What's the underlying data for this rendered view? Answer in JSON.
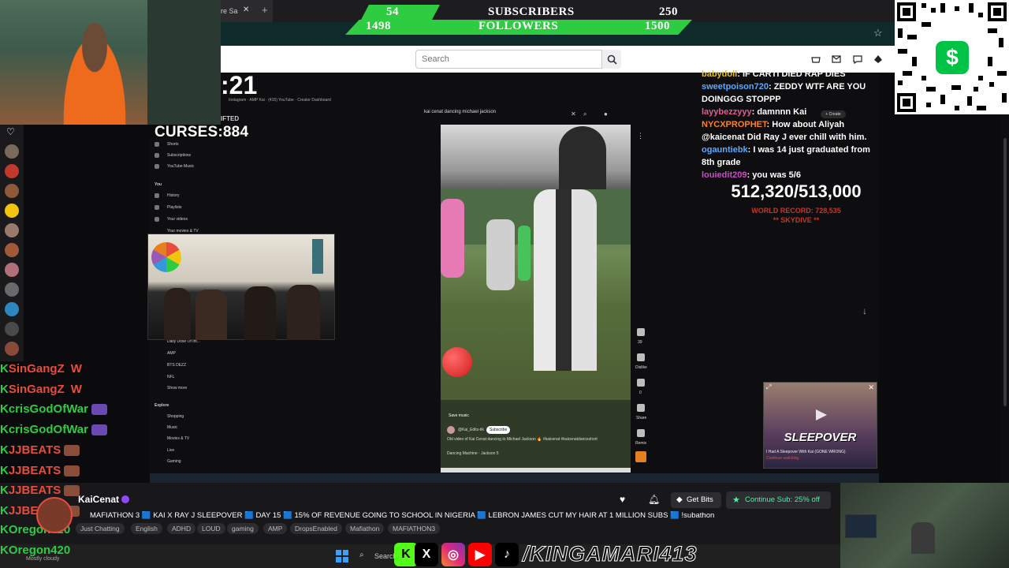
{
  "browser": {
    "tab_title": "re Sa",
    "new_tab_icon": "plus-icon",
    "bookmark_icon": "star-icon"
  },
  "overlay_counter": {
    "subs_current": "54",
    "subs_label": "SUBSCRIBERS",
    "subs_goal": "250",
    "followers_current": "1498",
    "followers_label": "FOLLOWERS",
    "followers_goal": "1500",
    "accent": "#2ecc40"
  },
  "header": {
    "search_placeholder": "Search",
    "icons": [
      "search-icon",
      "cart-icon",
      "inbox-icon",
      "chat-icon",
      "bits-icon"
    ]
  },
  "stream": {
    "timer": ":21",
    "curses": "CURSES:884",
    "browser_label": "IFTED",
    "yt_search_text": "kai cenat dancing michael jackson",
    "yt_sidebar": {
      "items_top": [
        "Shorts",
        "Subscriptions",
        "YouTube Music"
      ],
      "you_label": "You",
      "you_items": [
        "History",
        "Playlists",
        "Your videos",
        "Your movies & TV"
      ],
      "subs": [
        "Daily Dose Of Int...",
        "AMP",
        "BTS DEZZ",
        "NFL",
        "Show more"
      ],
      "explore_label": "Explore",
      "explore_items": [
        "Shopping",
        "Music",
        "Movies & TV",
        "Live",
        "Gaming"
      ]
    },
    "short": {
      "save_music": "Save music",
      "channel": "@Kai_Edits-tik",
      "subscribe": "Subscribe",
      "description": "Old video of Kai Cenat dancing to Michael Jackson 🔥 #kaicenat #kaicenatdanceshort",
      "music": "Dancing Machine · Jackson 5",
      "likes": "39",
      "dislike": "Dislike",
      "comments": "0",
      "share": "Share",
      "remix": "Remix"
    }
  },
  "chat_overlay": [
    {
      "user": "babydoll",
      "msg": ": IF CARTI DIED RAP DIES",
      "color": "#e6c229"
    },
    {
      "user": "sweetpoison720",
      "msg": ": ZEDDY WTF ARE YOU DOINGGG STOPPP",
      "color": "#5aa9ff"
    },
    {
      "user": "layybezzyyy",
      "msg": ": damnnn Kai",
      "color": "#e05d8c"
    },
    {
      "user": "NYCXPROPHET",
      "msg": ": How about Aliyah @kaicenat Did Ray J ever chill with him.",
      "color": "#ff7f24"
    },
    {
      "user": "ogauntiebk",
      "msg": ": I was 14 just graduated from 8th grade",
      "color": "#5aa9ff"
    },
    {
      "user": "louiedit209",
      "msg": ": you was 5/6",
      "color": "#c84ec2"
    }
  ],
  "sub_goal": {
    "count": "512,320/513,000",
    "world_record": "WORLD RECORD: 728,535",
    "next": "** SKYDIVE **"
  },
  "mini_player": {
    "title": "SLEEPOVER",
    "caption": "I Had A Sleepover With Kai (GONE WRONG)",
    "sub_caption": "Continue watching"
  },
  "left_chat": [
    {
      "name": "SinGangZ",
      "suffix": "W",
      "color": "#e74c3c"
    },
    {
      "name": "SinGangZ",
      "suffix": "W",
      "color": "#e74c3c"
    },
    {
      "name": "crisGodOfWar",
      "suffix": "",
      "color": "#2ecc40"
    },
    {
      "name": "crisGodOfWar",
      "suffix": "",
      "color": "#2ecc40"
    },
    {
      "name": "JJBEATS",
      "suffix": "",
      "color": "#e74c3c"
    },
    {
      "name": "JJBEATS",
      "suffix": "",
      "color": "#e74c3c"
    },
    {
      "name": "JJBEATS",
      "suffix": "",
      "color": "#e74c3c"
    },
    {
      "name": "JJBEATS",
      "suffix": "",
      "color": "#e74c3c"
    },
    {
      "name": "Oregon420",
      "suffix": "",
      "color": "#2ecc40"
    },
    {
      "name": "Oregon420",
      "suffix": "",
      "color": "#2ecc40"
    }
  ],
  "stream_info": {
    "channel": "KaiCenat",
    "title": "MAFIATHON 3 🟦 KAI X RAY J SLEEPOVER 🟦 DAY 15 🟦 15% OF REVENUE GOING TO SCHOOL IN NIGERIA 🟦 LEBRON JAMES CUT MY HAIR AT 1 MILLION SUBS 🟦 !subathon",
    "tags": [
      "Just Chatting",
      "English",
      "ADHD",
      "LOUD",
      "gaming",
      "AMP",
      "DropsEnabled",
      "Mafiathon",
      "MAFIATHON3"
    ],
    "get_bits": "Get Bits",
    "continue_sub": "Continue Sub: 25% off"
  },
  "social": {
    "handle": "/KINGAMARI413",
    "icons": [
      "kick-icon",
      "x-icon",
      "instagram-icon",
      "youtube-icon",
      "tiktok-icon"
    ],
    "search_label": "Search"
  },
  "weather": "Mostly cloudy"
}
